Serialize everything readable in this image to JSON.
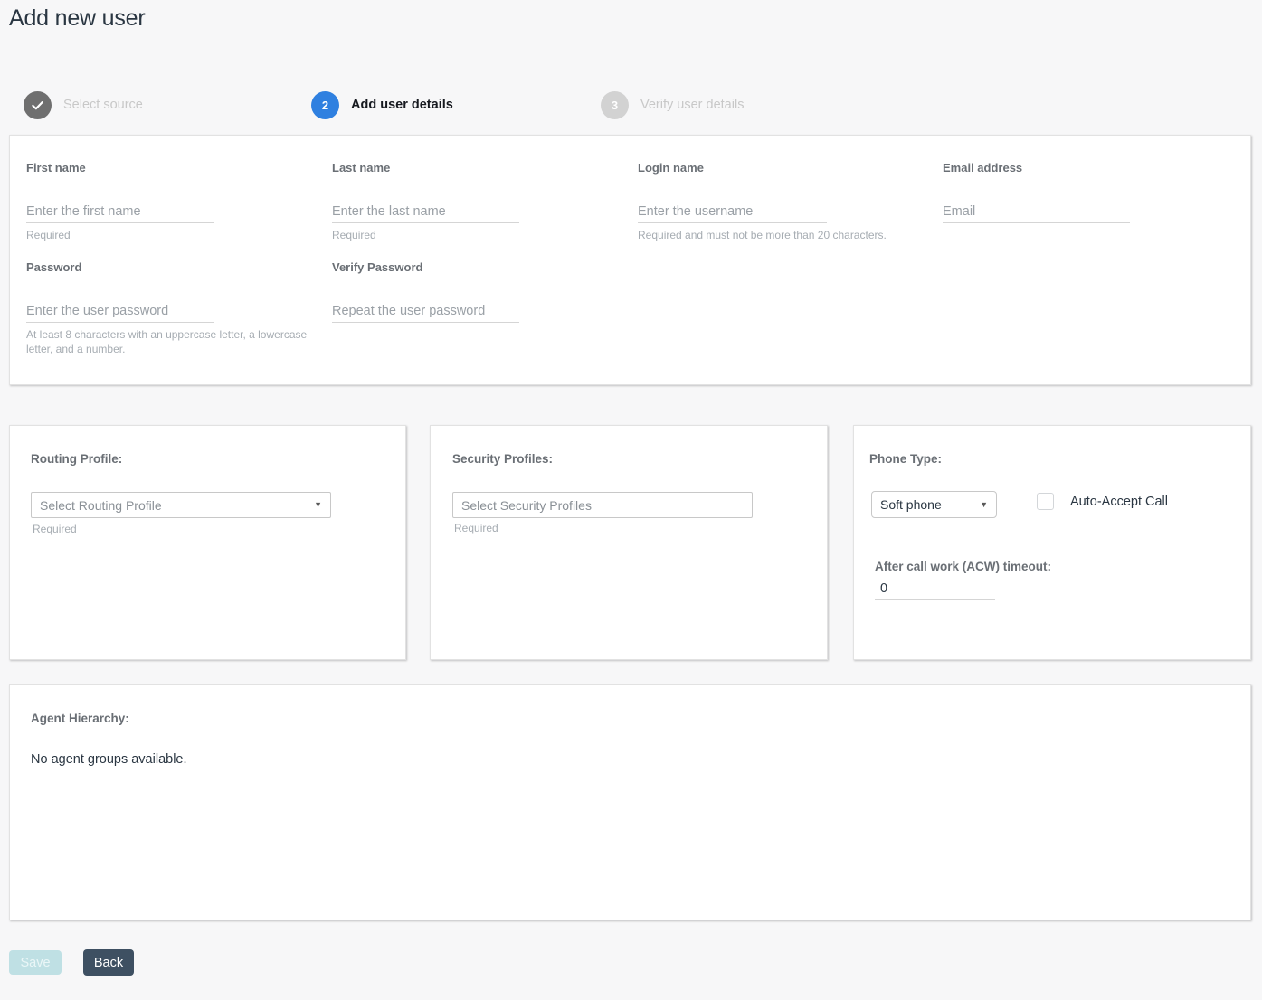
{
  "header": {
    "title": "Add new user"
  },
  "stepper": {
    "steps": [
      {
        "number": "",
        "label": "Select source",
        "state": "done",
        "icon": "check-icon"
      },
      {
        "number": "2",
        "label": "Add user details",
        "state": "active"
      },
      {
        "number": "3",
        "label": "Verify user details",
        "state": "todo"
      }
    ]
  },
  "details": {
    "first_name": {
      "label": "First name",
      "placeholder": "Enter the first name",
      "value": "",
      "hint": "Required"
    },
    "last_name": {
      "label": "Last name",
      "placeholder": "Enter the last name",
      "value": "",
      "hint": "Required"
    },
    "login_name": {
      "label": "Login name",
      "placeholder": "Enter the username",
      "value": "",
      "hint": "Required and must not be more than 20 characters."
    },
    "email": {
      "label": "Email address",
      "placeholder": "Email",
      "value": "",
      "hint": ""
    },
    "password": {
      "label": "Password",
      "placeholder": "Enter the user password",
      "value": "",
      "hint": "At least 8 characters with an uppercase letter, a lowercase letter, and a number."
    },
    "verify_password": {
      "label": "Verify Password",
      "placeholder": "Repeat the user password",
      "value": "",
      "hint": ""
    }
  },
  "routing": {
    "label": "Routing Profile:",
    "select_value": "Select Routing Profile",
    "caret": "▼",
    "hint": "Required"
  },
  "security": {
    "label": "Security Profiles:",
    "select_value": "Select Security Profiles",
    "hint": "Required"
  },
  "phone": {
    "label": "Phone Type:",
    "select_value": "Soft phone",
    "caret": "▼",
    "auto_accept_label": "Auto-Accept Call",
    "auto_accept_checked": false,
    "acw_label": "After call work (ACW) timeout:",
    "acw_value": "0"
  },
  "hierarchy": {
    "label": "Agent Hierarchy:",
    "empty_message": "No agent groups available."
  },
  "footer": {
    "save_label": "Save",
    "back_label": "Back"
  },
  "colors": {
    "page_background": "#f7f7f8",
    "card_background": "#ffffff",
    "active_step": "#2f80e0",
    "done_step": "#6f6f6f",
    "todo_step": "#d2d2d2",
    "save_disabled": "#bfe0e4",
    "back_button": "#3e5062",
    "label_text": "#6a6f75",
    "hint_text": "#a6acb2"
  }
}
